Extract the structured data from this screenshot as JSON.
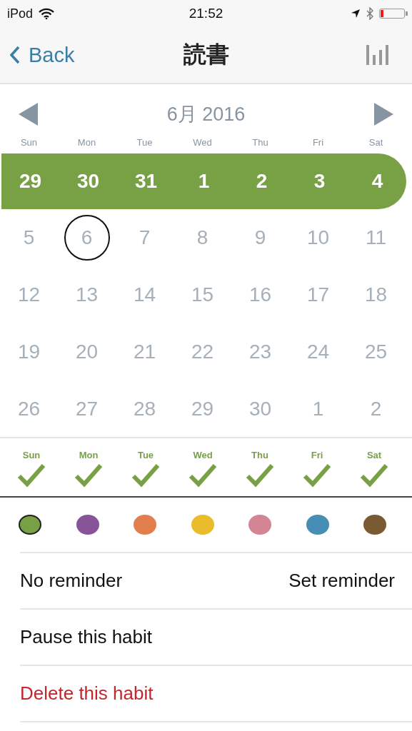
{
  "status_bar": {
    "carrier": "iPod",
    "time": "21:52"
  },
  "nav": {
    "back": "Back",
    "title": "読書"
  },
  "calendar": {
    "month": "6月 2016",
    "weekdays": [
      "Sun",
      "Mon",
      "Tue",
      "Wed",
      "Thu",
      "Fri",
      "Sat"
    ],
    "weeks": [
      {
        "selected": true,
        "days": [
          {
            "label": "29",
            "today": false
          },
          {
            "label": "30",
            "today": false
          },
          {
            "label": "31",
            "today": false
          },
          {
            "label": "1",
            "today": false
          },
          {
            "label": "2",
            "today": false
          },
          {
            "label": "3",
            "today": false
          },
          {
            "label": "4",
            "today": false
          }
        ]
      },
      {
        "selected": false,
        "days": [
          {
            "label": "5",
            "today": false
          },
          {
            "label": "6",
            "today": true
          },
          {
            "label": "7",
            "today": false
          },
          {
            "label": "8",
            "today": false
          },
          {
            "label": "9",
            "today": false
          },
          {
            "label": "10",
            "today": false
          },
          {
            "label": "11",
            "today": false
          }
        ]
      },
      {
        "selected": false,
        "days": [
          {
            "label": "12",
            "today": false
          },
          {
            "label": "13",
            "today": false
          },
          {
            "label": "14",
            "today": false
          },
          {
            "label": "15",
            "today": false
          },
          {
            "label": "16",
            "today": false
          },
          {
            "label": "17",
            "today": false
          },
          {
            "label": "18",
            "today": false
          }
        ]
      },
      {
        "selected": false,
        "days": [
          {
            "label": "19",
            "today": false
          },
          {
            "label": "20",
            "today": false
          },
          {
            "label": "21",
            "today": false
          },
          {
            "label": "22",
            "today": false
          },
          {
            "label": "23",
            "today": false
          },
          {
            "label": "24",
            "today": false
          },
          {
            "label": "25",
            "today": false
          }
        ]
      },
      {
        "selected": false,
        "days": [
          {
            "label": "26",
            "today": false
          },
          {
            "label": "27",
            "today": false
          },
          {
            "label": "28",
            "today": false
          },
          {
            "label": "29",
            "today": false
          },
          {
            "label": "30",
            "today": false
          },
          {
            "label": "1",
            "today": false
          },
          {
            "label": "2",
            "today": false
          }
        ]
      }
    ]
  },
  "schedule": [
    {
      "label": "Sun",
      "checked": true
    },
    {
      "label": "Mon",
      "checked": true
    },
    {
      "label": "Tue",
      "checked": true
    },
    {
      "label": "Wed",
      "checked": true
    },
    {
      "label": "Thu",
      "checked": true
    },
    {
      "label": "Fri",
      "checked": true
    },
    {
      "label": "Sat",
      "checked": true
    }
  ],
  "colors": [
    {
      "color": "#78a045",
      "selected": true
    },
    {
      "color": "#875399",
      "selected": false
    },
    {
      "color": "#e27e4d",
      "selected": false
    },
    {
      "color": "#e8bc2a",
      "selected": false
    },
    {
      "color": "#d48594",
      "selected": false
    },
    {
      "color": "#478eb5",
      "selected": false
    },
    {
      "color": "#7a5a32",
      "selected": false
    }
  ],
  "reminder": {
    "status": "No reminder",
    "action": "Set reminder"
  },
  "actions": [
    {
      "label": "Pause this habit",
      "kind": "normal"
    },
    {
      "label": "Delete this habit",
      "kind": "danger"
    }
  ]
}
